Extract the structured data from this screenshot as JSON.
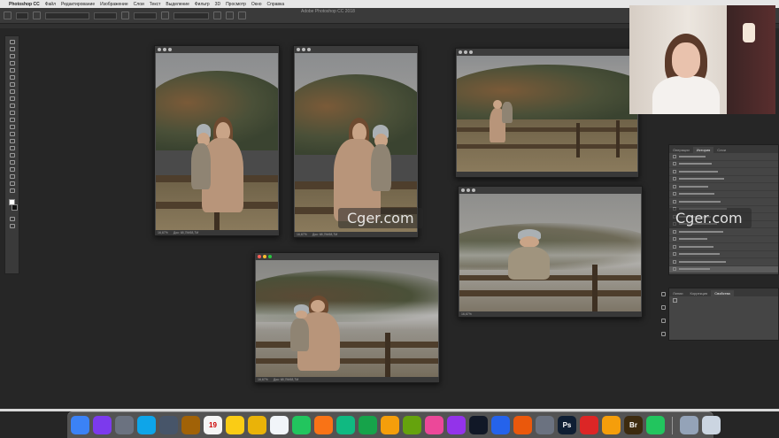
{
  "menubar": {
    "app_name": "Photoshop CC",
    "items": [
      "Файл",
      "Редактирование",
      "Изображение",
      "Слои",
      "Текст",
      "Выделение",
      "Фильтр",
      "3D",
      "Просмотр",
      "Окно",
      "Справка"
    ]
  },
  "window_title": "Adobe Photoshop CC 2018",
  "watermark": "Cger.com",
  "documents": [
    {
      "title": "",
      "zoom": "16,67%",
      "info": "Док: 68,7M/68,7M"
    },
    {
      "title": "",
      "zoom": "16,67%",
      "info": "Док: 68,7M/68,7M"
    },
    {
      "title": "",
      "zoom": "",
      "info": ""
    },
    {
      "title": "",
      "zoom": "16,67%",
      "info": ""
    },
    {
      "title": "",
      "zoom": "16,67%",
      "info": "Док: 68,7M/68,7M"
    }
  ],
  "history_panel": {
    "tabs": [
      "Операции",
      "История",
      "Слои"
    ],
    "active_tab": "История"
  },
  "properties_panel": {
    "tabs": [
      "Линии",
      "Коррекция",
      "Свойства"
    ],
    "active_tab": "Свойства"
  },
  "dock": {
    "apps": [
      {
        "name": "finder",
        "color": "#3b82f6"
      },
      {
        "name": "siri",
        "color": "#7c3aed"
      },
      {
        "name": "launchpad",
        "color": "#6b7280"
      },
      {
        "name": "safari",
        "color": "#0ea5e9"
      },
      {
        "name": "preview",
        "color": "#475569"
      },
      {
        "name": "contacts",
        "color": "#a16207"
      },
      {
        "name": "calendar",
        "color": "#f5f5f5",
        "label": "19"
      },
      {
        "name": "notes",
        "color": "#facc15"
      },
      {
        "name": "notes-2",
        "color": "#eab308"
      },
      {
        "name": "reminders",
        "color": "#f1f5f9"
      },
      {
        "name": "maps",
        "color": "#22c55e"
      },
      {
        "name": "photos",
        "color": "#f97316"
      },
      {
        "name": "messages",
        "color": "#10b981"
      },
      {
        "name": "facetime",
        "color": "#16a34a"
      },
      {
        "name": "pages",
        "color": "#f59e0b"
      },
      {
        "name": "numbers",
        "color": "#65a30d"
      },
      {
        "name": "itunes",
        "color": "#ec4899"
      },
      {
        "name": "podcasts",
        "color": "#9333ea"
      },
      {
        "name": "apple-tv",
        "color": "#111827"
      },
      {
        "name": "app-store",
        "color": "#2563eb"
      },
      {
        "name": "books",
        "color": "#ea580c"
      },
      {
        "name": "system-preferences",
        "color": "#6b7280"
      },
      {
        "name": "photoshop",
        "color": "#0f1e33",
        "label": "Ps"
      },
      {
        "name": "creative-cloud",
        "color": "#dc2626"
      },
      {
        "name": "chrome",
        "color": "#f59e0b"
      },
      {
        "name": "bridge",
        "color": "#3d2b0f",
        "label": "Br"
      },
      {
        "name": "whatsapp",
        "color": "#22c55e"
      },
      {
        "name": "downloads",
        "color": "#94a3b8"
      },
      {
        "name": "trash",
        "color": "#cbd5e1"
      }
    ]
  }
}
